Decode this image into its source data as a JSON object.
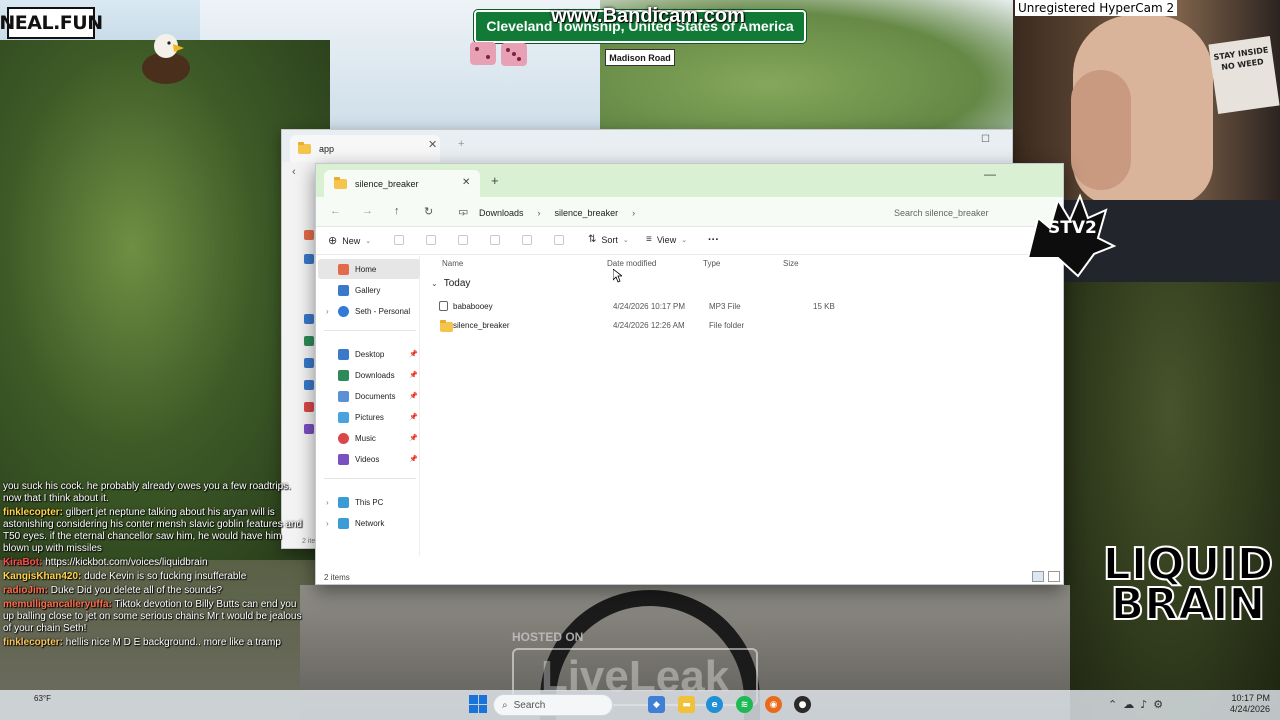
{
  "overlays": {
    "neal_fun": "NEAL.FUN",
    "bandicam": "www.Bandicam.com",
    "location": "Cleveland Township, United States of America",
    "street": "Madison Road",
    "hypercam": "Unregistered HyperCam 2",
    "poster": "STAY INSIDE NO WEED",
    "stv2": "STV2",
    "hosted_on": "HOSTED ON",
    "liveleak": "LiveLeak",
    "liquid_brain": "LIQUID BRAIN"
  },
  "chat": [
    {
      "user": "",
      "text": "you suck his cock. he probably already owes you a few roadtrips. now that I think about it."
    },
    {
      "user": "finklecopter:",
      "text": "gilbert jet neptune talking about his aryan will is astonishing considering his conter mensh slavic goblin features and T50 eyes. if the eternal chancellor saw him, he would have him blown up with missiles"
    },
    {
      "user": "KiraBot:",
      "text": "https://kickbot.com/voices/liquidbrain"
    },
    {
      "user": "KangisKhan420:",
      "text": "dude Kevin is so fucking insufferable"
    },
    {
      "user": "radioJim:",
      "text": "Duke Did you delete all of the sounds?"
    },
    {
      "user": "memulligancalleryuffa:",
      "text": "Tiktok devotion to Billy Butts can end you up balling close to jet on some serious chains Mr t would be jealous of your chain Seth!"
    },
    {
      "user": "finklecopter:",
      "text": "hellis nice M D E background.. more like a tramp"
    }
  ],
  "back_window": {
    "tab_title": "app",
    "status": "2 items"
  },
  "explorer": {
    "tab_title": "silence_breaker",
    "breadcrumb": [
      "Downloads",
      "silence_breaker"
    ],
    "search_placeholder": "Search silence_breaker",
    "toolbar": {
      "new": "New",
      "sort": "Sort",
      "view": "View",
      "more": "···"
    },
    "nav": {
      "home": "Home",
      "gallery": "Gallery",
      "personal": "Seth - Personal",
      "desktop": "Desktop",
      "downloads": "Downloads",
      "documents": "Documents",
      "pictures": "Pictures",
      "music": "Music",
      "videos": "Videos",
      "this_pc": "This PC",
      "network": "Network"
    },
    "columns": {
      "name": "Name",
      "date": "Date modified",
      "type": "Type",
      "size": "Size"
    },
    "group": "Today",
    "files": [
      {
        "name": "bababooey",
        "date": "4/24/2026 10:17 PM",
        "type": "MP3 File",
        "size": "15 KB"
      },
      {
        "name": "silence_breaker",
        "date": "4/24/2026 12:26 AM",
        "type": "File folder",
        "size": ""
      }
    ],
    "status": "2 items"
  },
  "taskbar": {
    "search_placeholder": "Search",
    "weather": "63°F",
    "time": "10:17 PM",
    "date": "4/24/2026"
  }
}
